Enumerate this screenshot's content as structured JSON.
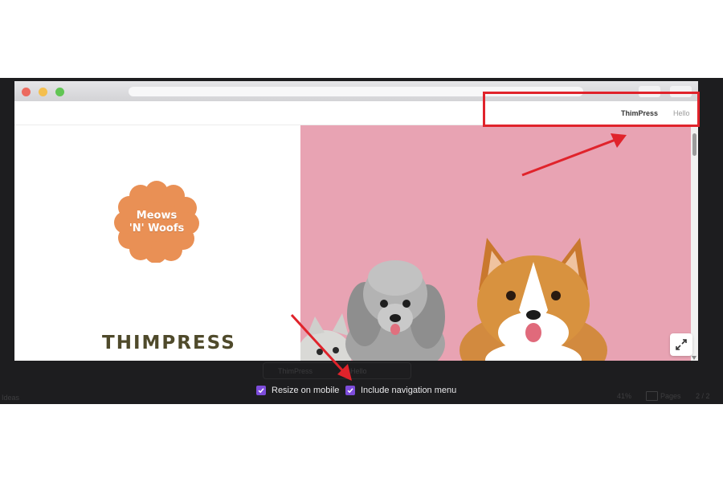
{
  "site": {
    "nav": [
      {
        "label": "ThimPress",
        "active": true
      },
      {
        "label": "Hello",
        "active": false
      }
    ],
    "badge_text_line1": "Meows",
    "badge_text_line2": "'N' Woofs",
    "brand_name": "THIMPRESS",
    "hero_background_color": "#e8a3b3",
    "badge_color": "#e99055"
  },
  "editor": {
    "faint_tabs": [
      "ThimPress",
      "Hello"
    ],
    "options": [
      {
        "label": "Resize on mobile",
        "checked": true
      },
      {
        "label": "Include navigation menu",
        "checked": true
      }
    ],
    "checkbox_color": "#7d4cdb",
    "ghost_left": "Ideas",
    "zoom": "41%",
    "pages_label": "Pages",
    "page_count": "2 / 2"
  },
  "annotation": {
    "color": "#e0232b"
  },
  "icons": [
    "close-dot",
    "minimize-dot",
    "zoom-dot",
    "expand-icon",
    "check-icon",
    "pages-icon"
  ]
}
